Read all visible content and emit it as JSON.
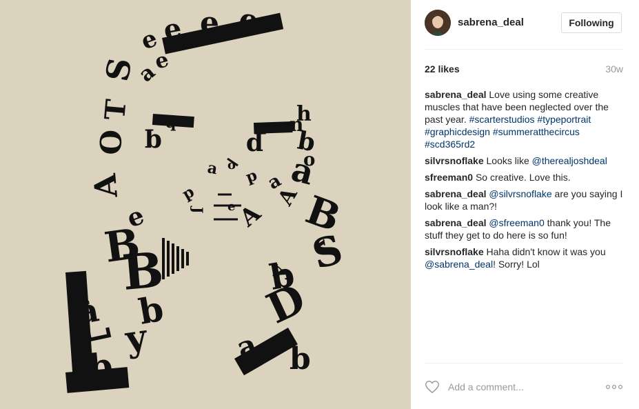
{
  "post": {
    "username": "sabrena_deal",
    "follow_label": "Following",
    "likes": "22 likes",
    "age": "30w",
    "comments": [
      {
        "author": "sabrena_deal",
        "parts": [
          {
            "text": "Love using some creative muscles that have been neglected over the past year. ",
            "link": false
          },
          {
            "text": "#scarterstudios",
            "link": true
          },
          {
            "text": " ",
            "link": false
          },
          {
            "text": "#typeportrait",
            "link": true
          },
          {
            "text": " ",
            "link": false
          },
          {
            "text": "#graphicdesign",
            "link": true
          },
          {
            "text": " ",
            "link": false
          },
          {
            "text": "#summeratthecircus",
            "link": true
          },
          {
            "text": " ",
            "link": false
          },
          {
            "text": "#scd365rd2",
            "link": true
          }
        ]
      },
      {
        "author": "silvrsnoflake",
        "parts": [
          {
            "text": "Looks like ",
            "link": false
          },
          {
            "text": "@therealjoshdeal",
            "link": true
          }
        ]
      },
      {
        "author": "sfreeman0",
        "parts": [
          {
            "text": "So creative. Love this.",
            "link": false
          }
        ]
      },
      {
        "author": "sabrena_deal",
        "parts": [
          {
            "text": "@silvrsnoflake",
            "link": true
          },
          {
            "text": " are you saying I look like a man?!",
            "link": false
          }
        ]
      },
      {
        "author": "sabrena_deal",
        "parts": [
          {
            "text": "@sfreeman0",
            "link": true
          },
          {
            "text": " thank you! The stuff they get to do here is so fun!",
            "link": false
          }
        ]
      },
      {
        "author": "silvrsnoflake",
        "parts": [
          {
            "text": "Haha didn't know it was you ",
            "link": false
          },
          {
            "text": "@sabrena_deal",
            "link": true
          },
          {
            "text": "! Sorry! Lol",
            "link": false
          }
        ]
      }
    ],
    "comment_placeholder": "Add a comment...",
    "icons": {
      "like": "heart-icon",
      "more": "more-options-icon"
    }
  },
  "artwork": {
    "glyphs": [
      "e",
      "e",
      "e",
      "e",
      "S",
      "T",
      "O",
      "A",
      "e",
      "B",
      "L",
      "B",
      "a",
      "b",
      "y",
      "b",
      "e",
      "h",
      "a",
      "B",
      "S",
      "D",
      "b",
      "b",
      "a",
      "v",
      "b",
      "A",
      "A",
      "y",
      "q",
      "p",
      "q",
      "p",
      "J",
      "e",
      "p",
      "o",
      "a",
      "p",
      "a",
      "o",
      "a",
      "n",
      "P"
    ]
  },
  "colors": {
    "background": "#dcd3be",
    "ink": "#111111",
    "link": "#003569",
    "muted": "#999999"
  }
}
